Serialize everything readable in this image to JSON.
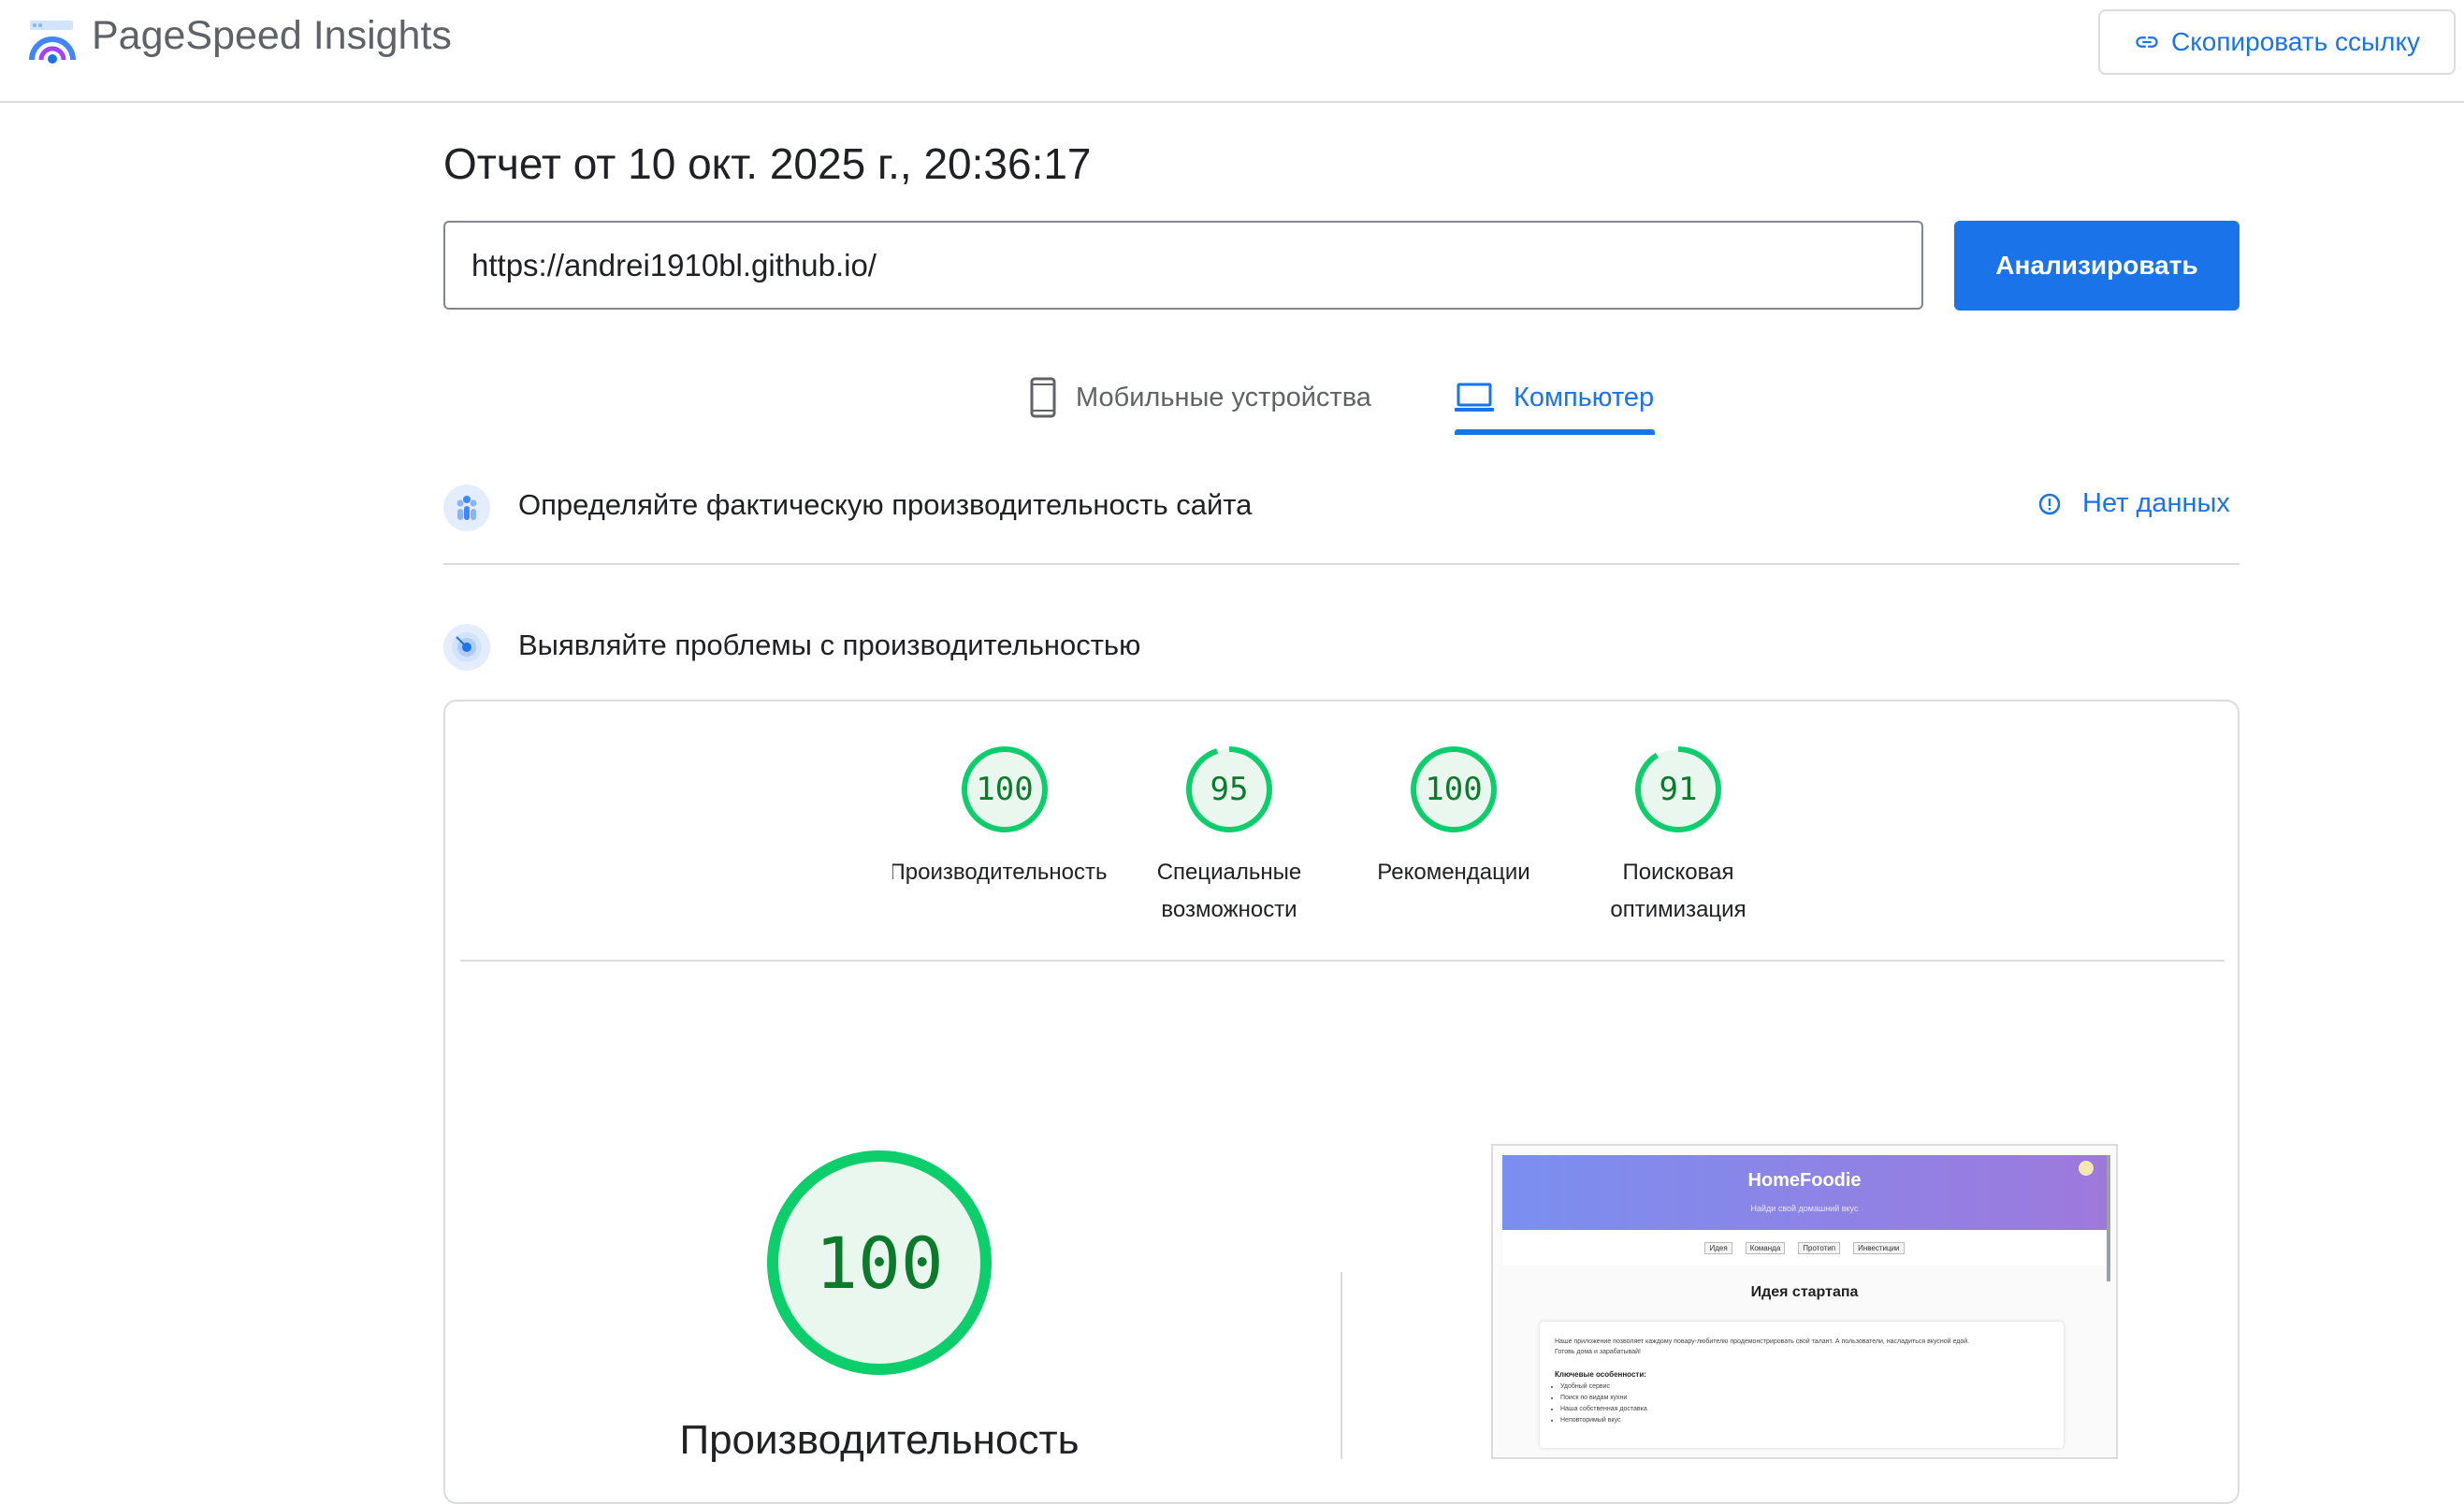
{
  "header": {
    "app_title": "PageSpeed Insights",
    "copy_link_label": "Скопировать ссылку",
    "logo_icon": "pagespeed-logo-icon",
    "copy_icon": "link-icon"
  },
  "report": {
    "title": "Отчет от 10 окт. 2025 г., 20:36:17",
    "url_value": "https://andrei1910bl.github.io/",
    "analyze_label": "Анализировать"
  },
  "tabs": [
    {
      "label": "Мобильные устройства",
      "icon": "smartphone-icon",
      "selected": false
    },
    {
      "label": "Компьютер",
      "icon": "laptop-icon",
      "selected": true
    }
  ],
  "field_section": {
    "title": "Определяйте фактическую производительность сайта",
    "status_label": "Нет данных",
    "icon": "users-icon",
    "status_icon": "info-icon"
  },
  "lab_section": {
    "title": "Выявляйте проблемы с производительностью",
    "icon": "radar-icon"
  },
  "scores": [
    {
      "value": "100",
      "label_line1": "Производительность",
      "label_line2": "",
      "fraction": 1.0
    },
    {
      "value": "95",
      "label_line1": "Специальные",
      "label_line2": "возможности",
      "fraction": 0.95
    },
    {
      "value": "100",
      "label_line1": "Рекомендации",
      "label_line2": "",
      "fraction": 1.0
    },
    {
      "value": "91",
      "label_line1": "Поисковая",
      "label_line2": "оптимизация",
      "fraction": 0.91
    }
  ],
  "main_score": {
    "value": "100",
    "label": "Производительность",
    "fraction": 1.0
  },
  "preview": {
    "brand": "HomeFoodie",
    "tagline": "Найди свой домашний вкус",
    "nav": [
      "Идея",
      "Команда",
      "Прототип",
      "Инвестиции"
    ],
    "heading": "Идея стартапа",
    "description_1": "Наше приложение позволяет каждому повару-любителю продемонстрировать свой талант. А пользователи, насладиться вкусной едой.",
    "description_2": "Готовь дома и зарабатывай!",
    "features_title": "Ключевые особенности:",
    "features": [
      "Удобный сервис",
      "Поиск по видам кухни",
      "Наша собственная доставка",
      "Неповторимый вкус"
    ]
  },
  "colors": {
    "accent": "#1a73e8",
    "score_good": "#0cce6b",
    "score_good_text": "#0c7a2b",
    "score_good_fill": "#eaf7ee"
  }
}
